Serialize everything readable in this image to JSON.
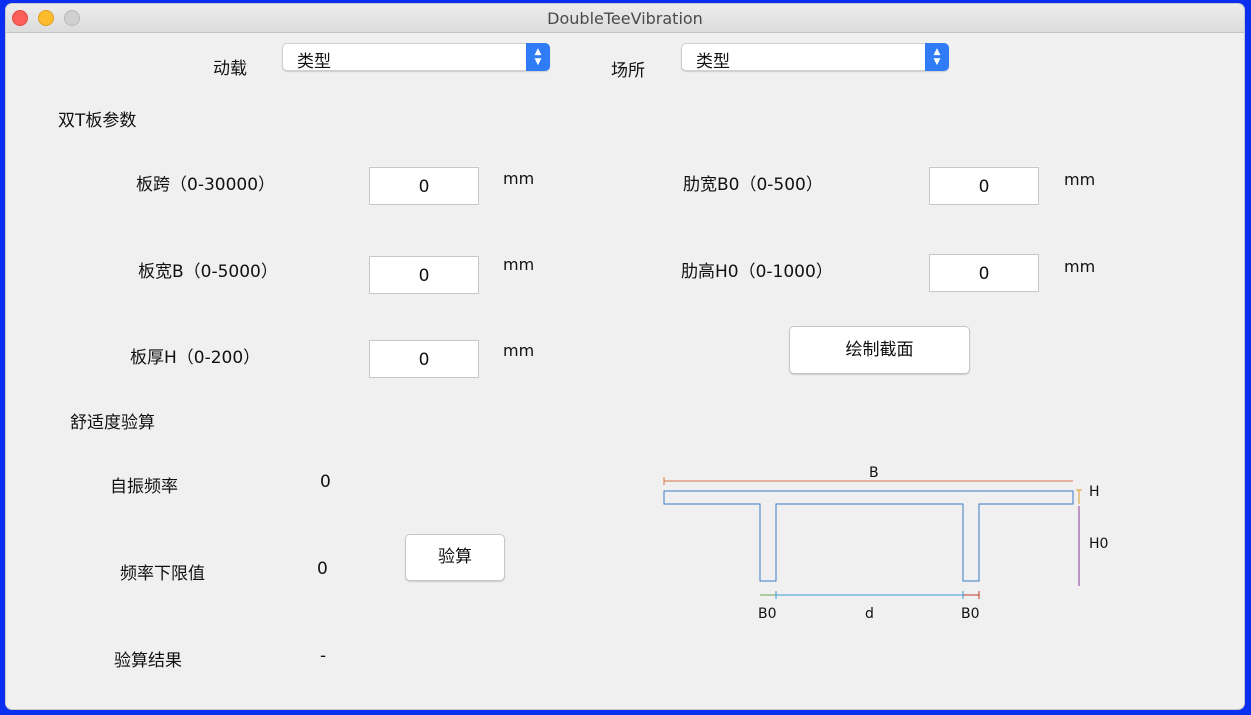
{
  "window": {
    "title": "DoubleTeeVibration"
  },
  "top_controls": {
    "load_label": "动载",
    "load_select_value": "类型",
    "site_label": "场所",
    "site_select_value": "类型"
  },
  "params": {
    "section_title": "双T板参数",
    "span_label": "板跨（0-30000）",
    "span_value": "0",
    "width_label": "板宽B（0-5000）",
    "width_value": "0",
    "thick_label": "板厚H（0-200）",
    "thick_value": "0",
    "rib_width_label": "肋宽B0（0-500）",
    "rib_width_value": "0",
    "rib_height_label": "肋高H0（0-1000）",
    "rib_height_value": "0",
    "unit": "mm",
    "draw_button": "绘制截面"
  },
  "comfort": {
    "section_title": "舒适度验算",
    "natural_freq_label": "自振频率",
    "natural_freq_value": "0",
    "freq_lower_label": "频率下限值",
    "freq_lower_value": "0",
    "result_label": "验算结果",
    "result_value": "-",
    "check_button": "验算"
  },
  "diagram": {
    "label_B": "B",
    "label_H": "H",
    "label_H0": "H0",
    "label_B0_left": "B0",
    "label_d": "d",
    "label_B0_right": "B0"
  }
}
